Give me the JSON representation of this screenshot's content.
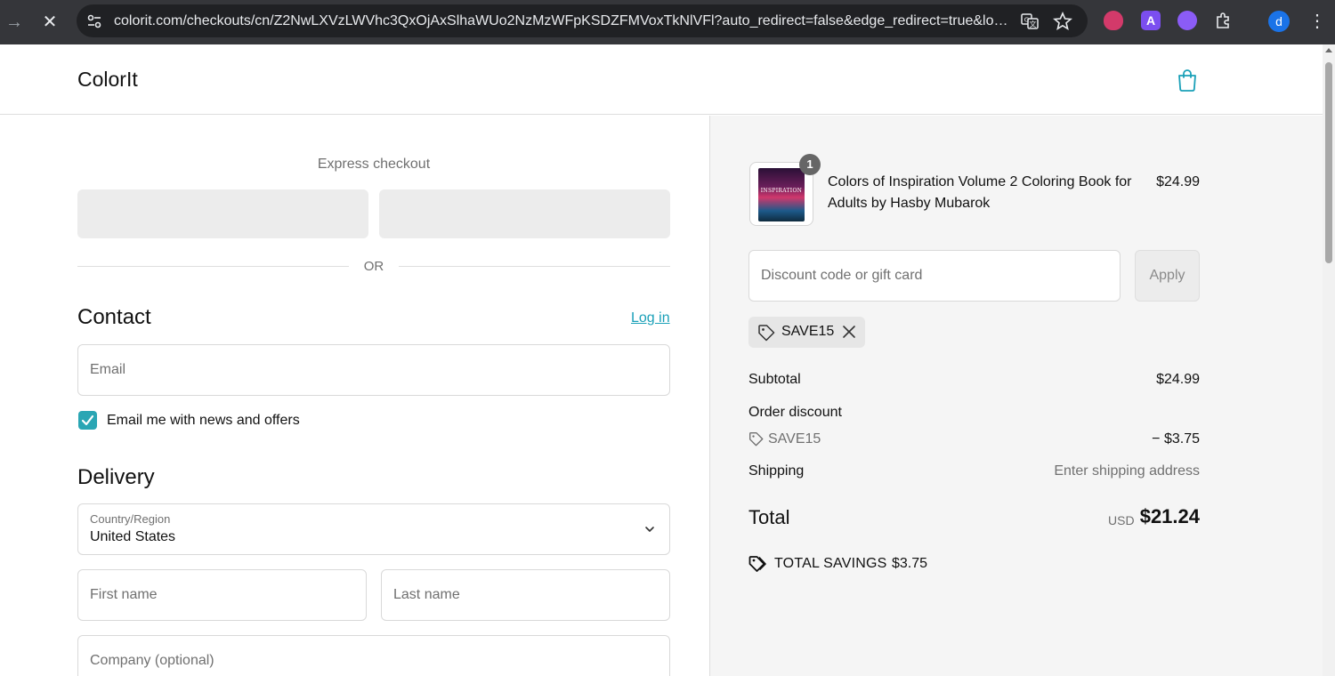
{
  "browser": {
    "url": "colorit.com/checkouts/cn/Z2NwLXVzLWVhc3QxOjAxSlhaWUo2NzMzWFpKSDZFMVoxTkNlVFl?auto_redirect=false&edge_redirect=true&loca...",
    "profile_initial": "d",
    "icons": [
      "forward-icon",
      "stop-icon",
      "site-info-icon",
      "translate-icon",
      "star-icon",
      "ublock-icon",
      "extension-a-icon",
      "extension-purple-icon",
      "puzzle-icon",
      "kebab-menu-icon"
    ]
  },
  "header": {
    "logo": "ColorIt",
    "bag_icon": "shopping-bag-icon",
    "accent": "#1aa0b8"
  },
  "checkout": {
    "express_title": "Express checkout",
    "or_text": "OR",
    "contact": {
      "title": "Contact",
      "login": "Log in",
      "email_placeholder": "Email",
      "newsletter_label": "Email me with news and offers",
      "newsletter_checked": true
    },
    "delivery": {
      "title": "Delivery",
      "country_label": "Country/Region",
      "country_value": "United States",
      "first_name_placeholder": "First name",
      "last_name_placeholder": "Last name",
      "company_placeholder": "Company (optional)"
    }
  },
  "summary": {
    "item": {
      "quantity": "1",
      "name": "Colors of Inspiration Volume 2 Coloring Book for Adults by Hasby Mubarok",
      "price": "$24.99",
      "cover_text": "INSPIRATION"
    },
    "discount_placeholder": "Discount code or gift card",
    "apply_label": "Apply",
    "applied_code": "SAVE15",
    "subtotal_label": "Subtotal",
    "subtotal_value": "$24.99",
    "order_discount_label": "Order discount",
    "order_discount_code": "SAVE15",
    "order_discount_value": "− $3.75",
    "shipping_label": "Shipping",
    "shipping_value": "Enter shipping address",
    "total_label": "Total",
    "total_currency": "USD",
    "total_value": "$21.24",
    "savings_label": "TOTAL SAVINGS",
    "savings_value": "$3.75"
  }
}
